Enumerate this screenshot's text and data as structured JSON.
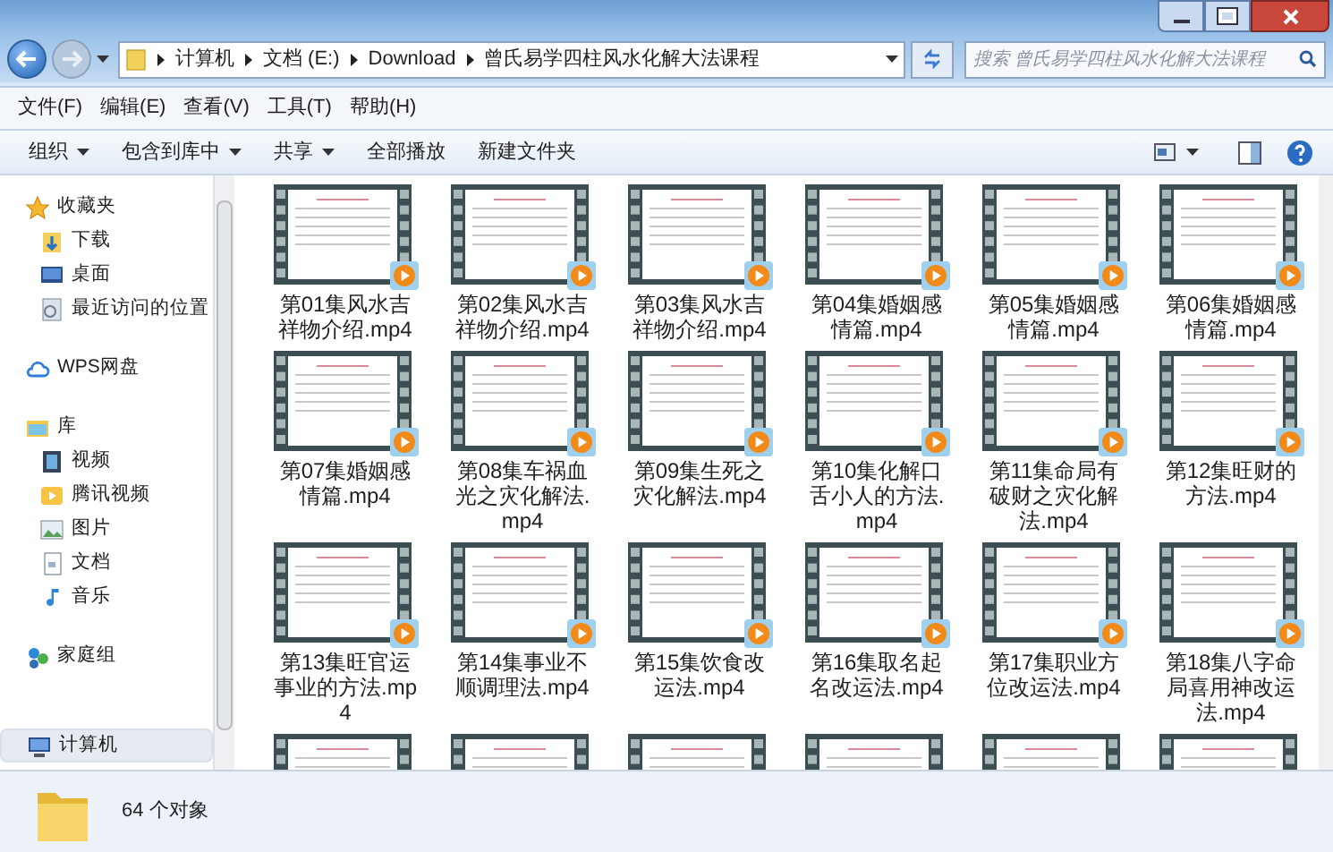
{
  "address_bar": {
    "crumbs": [
      "计算机",
      "文档 (E:)",
      "Download",
      "曾氏易学四柱风水化解大法课程"
    ]
  },
  "search": {
    "placeholder": "搜索 曾氏易学四柱风水化解大法课程"
  },
  "menu": [
    "文件(F)",
    "编辑(E)",
    "查看(V)",
    "工具(T)",
    "帮助(H)"
  ],
  "toolbar": [
    {
      "label": "组织",
      "dropdown": true
    },
    {
      "label": "包含到库中",
      "dropdown": true
    },
    {
      "label": "共享",
      "dropdown": true
    },
    {
      "label": "全部播放",
      "dropdown": false
    },
    {
      "label": "新建文件夹",
      "dropdown": false
    }
  ],
  "sidebar": {
    "groups": [
      {
        "label": "收藏夹",
        "kind": "favorites",
        "selected": false,
        "children": [
          {
            "label": "下载",
            "kind": "download",
            "selected": false
          },
          {
            "label": "桌面",
            "kind": "desktop",
            "selected": false
          },
          {
            "label": "最近访问的位置",
            "kind": "recent",
            "selected": false
          }
        ]
      },
      {
        "label": "WPS网盘",
        "kind": "cloud",
        "selected": false
      },
      {
        "label": "库",
        "kind": "library",
        "selected": false,
        "children": [
          {
            "label": "视频",
            "kind": "video",
            "selected": false
          },
          {
            "label": "腾讯视频",
            "kind": "tencent",
            "selected": false
          },
          {
            "label": "图片",
            "kind": "pictures",
            "selected": false
          },
          {
            "label": "文档",
            "kind": "documents",
            "selected": false
          },
          {
            "label": "音乐",
            "kind": "music",
            "selected": false
          }
        ]
      },
      {
        "label": "家庭组",
        "kind": "homegroup",
        "selected": false
      },
      {
        "label": "计算机",
        "kind": "computer",
        "selected": true
      }
    ]
  },
  "files": [
    {
      "name": "第01集风水吉祥物介绍.mp4"
    },
    {
      "name": "第02集风水吉祥物介绍.mp4"
    },
    {
      "name": "第03集风水吉祥物介绍.mp4"
    },
    {
      "name": "第04集婚姻感情篇.mp4"
    },
    {
      "name": "第05集婚姻感情篇.mp4"
    },
    {
      "name": "第06集婚姻感情篇.mp4"
    },
    {
      "name": "第07集婚姻感情篇.mp4"
    },
    {
      "name": "第08集车祸血光之灾化解法.mp4"
    },
    {
      "name": "第09集生死之灾化解法.mp4"
    },
    {
      "name": "第10集化解口舌小人的方法.mp4"
    },
    {
      "name": "第11集命局有破财之灾化解法.mp4"
    },
    {
      "name": "第12集旺财的方法.mp4"
    },
    {
      "name": "第13集旺官运事业的方法.mp4"
    },
    {
      "name": "第14集事业不顺调理法.mp4"
    },
    {
      "name": "第15集饮食改运法.mp4"
    },
    {
      "name": "第16集取名起名改运法.mp4"
    },
    {
      "name": "第17集职业方位改运法.mp4"
    },
    {
      "name": "第18集八字命局喜用神改运法.mp4"
    }
  ],
  "status_bar": {
    "count": "64 个对象"
  }
}
